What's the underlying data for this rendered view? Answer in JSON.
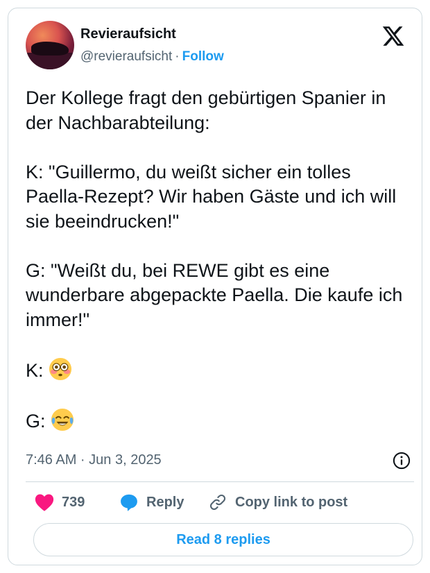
{
  "author": {
    "name": "Revieraufsicht",
    "handle": "@revieraufsicht",
    "separator": "·",
    "follow_label": "Follow"
  },
  "tweet": {
    "line1": "Der Kollege fragt den gebürtigen Spanier in der Nachbarabteilung:",
    "line2": "K: \"Guillermo, du weißt sicher ein tolles Paella-Rezept? Wir haben Gäste und ich will sie beeindrucken!\"",
    "line3": "G: \"Weißt du, bei REWE gibt es eine wunderbare abgepackte Paella. Die kaufe ich immer!\"",
    "line4_prefix": "K: ",
    "line4_emoji": "flushed-face",
    "line5_prefix": "G: ",
    "line5_emoji": "face-with-tears-of-joy"
  },
  "timestamp": "7:46 AM · Jun 3, 2025",
  "actions": {
    "like_count": "739",
    "reply_label": "Reply",
    "copy_label": "Copy link to post"
  },
  "read_replies_label": "Read 8 replies",
  "colors": {
    "accent": "#1d9bf0",
    "like": "#f91880",
    "text": "#0f1419",
    "muted": "#536471",
    "border": "#cfd9de"
  },
  "icons": [
    "x-logo-icon",
    "info-icon",
    "heart-icon",
    "reply-bubble-icon",
    "link-icon"
  ]
}
